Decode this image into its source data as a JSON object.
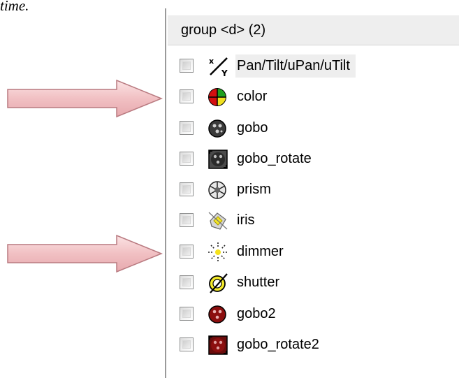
{
  "document": {
    "fragment_text": "time."
  },
  "panel": {
    "group_header": "group <d> (2)",
    "items": [
      {
        "label": "Pan/Tilt/uPan/uTilt",
        "icon": "pan-tilt-icon",
        "checked": false
      },
      {
        "label": "color",
        "icon": "color-wheel-icon",
        "checked": false
      },
      {
        "label": "gobo",
        "icon": "gobo-icon",
        "checked": false
      },
      {
        "label": "gobo_rotate",
        "icon": "gobo-rotate-icon",
        "checked": false
      },
      {
        "label": "prism",
        "icon": "prism-icon",
        "checked": false
      },
      {
        "label": "iris",
        "icon": "iris-icon",
        "checked": false
      },
      {
        "label": "dimmer",
        "icon": "dimmer-icon",
        "checked": false
      },
      {
        "label": "shutter",
        "icon": "shutter-icon",
        "checked": false
      },
      {
        "label": "gobo2",
        "icon": "gobo2-icon",
        "checked": false
      },
      {
        "label": "gobo_rotate2",
        "icon": "gobo-rotate2-icon",
        "checked": false
      }
    ]
  },
  "annotations": {
    "arrow_color": "#f2c4c6",
    "arrow_border": "#b97a80"
  }
}
